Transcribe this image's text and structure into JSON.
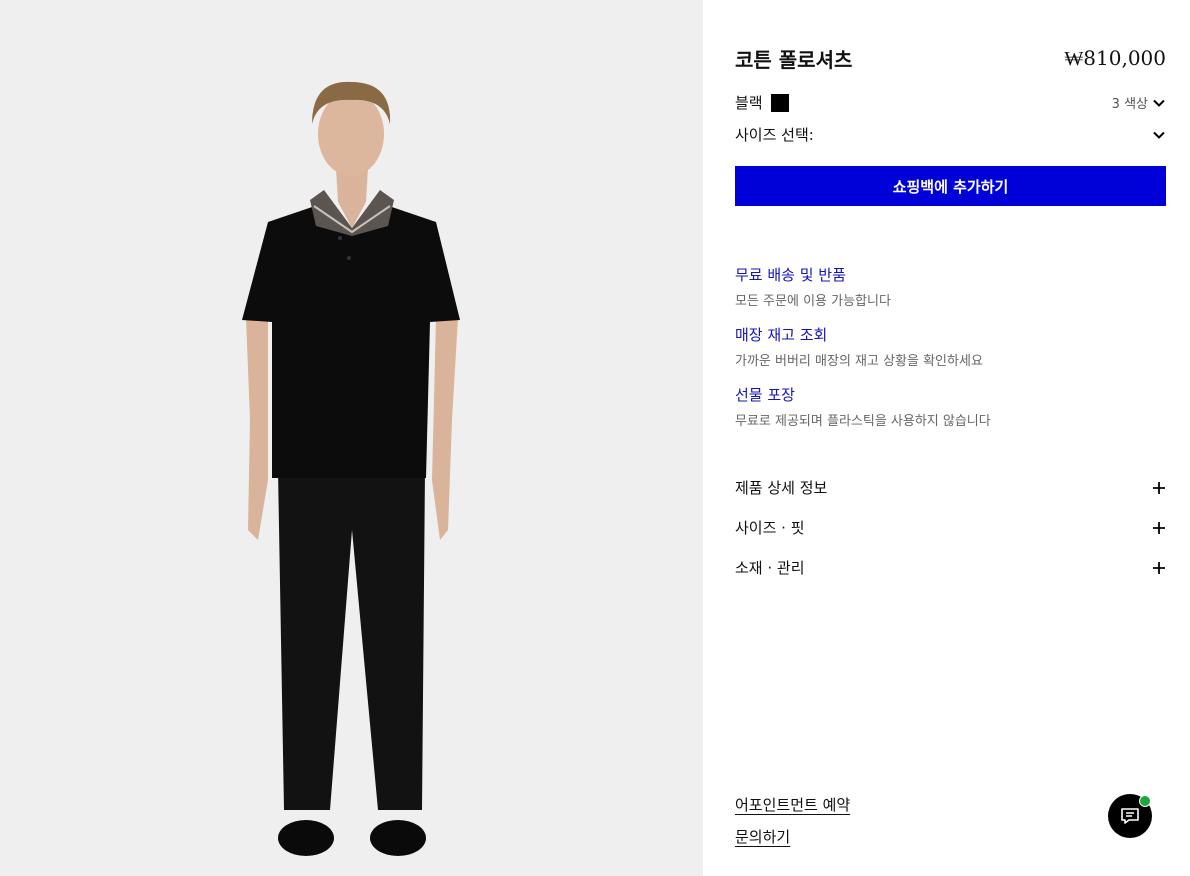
{
  "product": {
    "title": "코튼 폴로셔츠",
    "price": "₩810,000",
    "color_name": "블랙",
    "color_swatch": "#000000",
    "color_count": "3 색상",
    "size_label": "사이즈 선택:",
    "add_to_bag": "쇼핑백에 추가하기"
  },
  "services": [
    {
      "title": "무료 배송 및 반품",
      "desc": "모든 주문에 이용 가능합니다"
    },
    {
      "title": "매장 재고 조회",
      "desc": "가까운 버버리 매장의 재고 상황을 확인하세요"
    },
    {
      "title": "선물 포장",
      "desc": "무료로 제공되며 플라스틱을 사용하지 않습니다"
    }
  ],
  "accordions": [
    {
      "label": "제품 상세 정보"
    },
    {
      "label": "사이즈 · 핏"
    },
    {
      "label": "소재 · 관리"
    }
  ],
  "links": {
    "appointment": "어포인트먼트 예약",
    "inquiry": "문의하기"
  },
  "colors": {
    "accent_blue": "#0000d9",
    "link_blue": "#1414b8",
    "chat_status": "#1fa83a"
  },
  "icons": {
    "chevron": "chevron-down-icon",
    "plus": "plus-icon",
    "chat": "chat-icon"
  }
}
